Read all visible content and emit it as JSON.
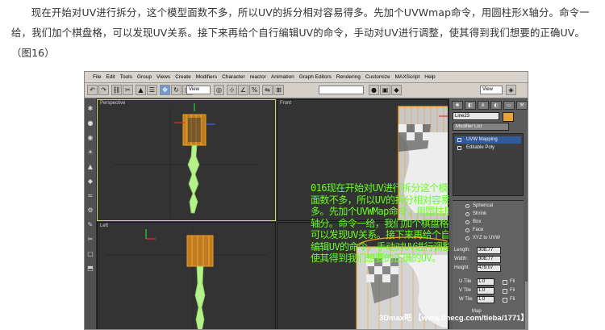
{
  "article": {
    "paragraph": "现在开始对UV进行拆分，这个模型面数不多，所以UV的拆分相对容易得多。先加个UVWmap命令，用圆柱形X轴分。命令一给，我们加个棋盘格，可以发现UV关系。接下来再给个自行编辑UV的命令，手动对UV进行调整，使其得到我们想要的正确UV。（图16）"
  },
  "app": {
    "menu": [
      "File",
      "Edit",
      "Tools",
      "Group",
      "Views",
      "Create",
      "Modifiers",
      "Character",
      "reactor",
      "Animation",
      "Graph Editors",
      "Rendering",
      "Customize",
      "MAXScript",
      "Help"
    ],
    "toolbar": {
      "view_dropdown": "View",
      "view_dropdown_2": "View"
    },
    "viewports": {
      "top_left": "Perspective",
      "top_right": "Front",
      "bottom_left": "Left",
      "bottom_right": ""
    },
    "command_panel": {
      "object_name": "Line23",
      "modifier_list": "Modifier List",
      "stack": [
        "UVW Mapping",
        "Editable Poly"
      ],
      "mapping_options": [
        "Spherical",
        "Shrink",
        "Box",
        "Face",
        "XYZ to UVW"
      ],
      "params": {
        "length_label": "Length:",
        "length_value": "308.77",
        "width_label": "Width:",
        "width_value": "308.77",
        "height_label": "Height:",
        "height_value": "479.07",
        "utile_label": "U Tile",
        "utile_value": "1.0",
        "vtile_label": "V Tile",
        "vtile_value": "1.0",
        "wtile_label": "W Tile",
        "wtile_value": "1.0",
        "flip_label": "Fli",
        "map_label": "Map"
      }
    },
    "caption": "016现在开始对UV进行拆分这个模型面数不多，所以UV的拆分相对容易得多。先加个UVWMap命令，用圆柱形X轴分。命令一给，我们加个棋盘格，可以发现UV关系。接下来再给个自行编辑UV的命令，手动对UV进行调整，使其得到我们想要的正确的UV。",
    "watermark": "3Dmax吧 【www.linecg.com/tieba/1771】",
    "colors": {
      "caption_green": "#66ff22",
      "model_green": "#b6f08a",
      "gizmo_orange": "#f0a020",
      "selection_blue": "#325a9a"
    }
  }
}
